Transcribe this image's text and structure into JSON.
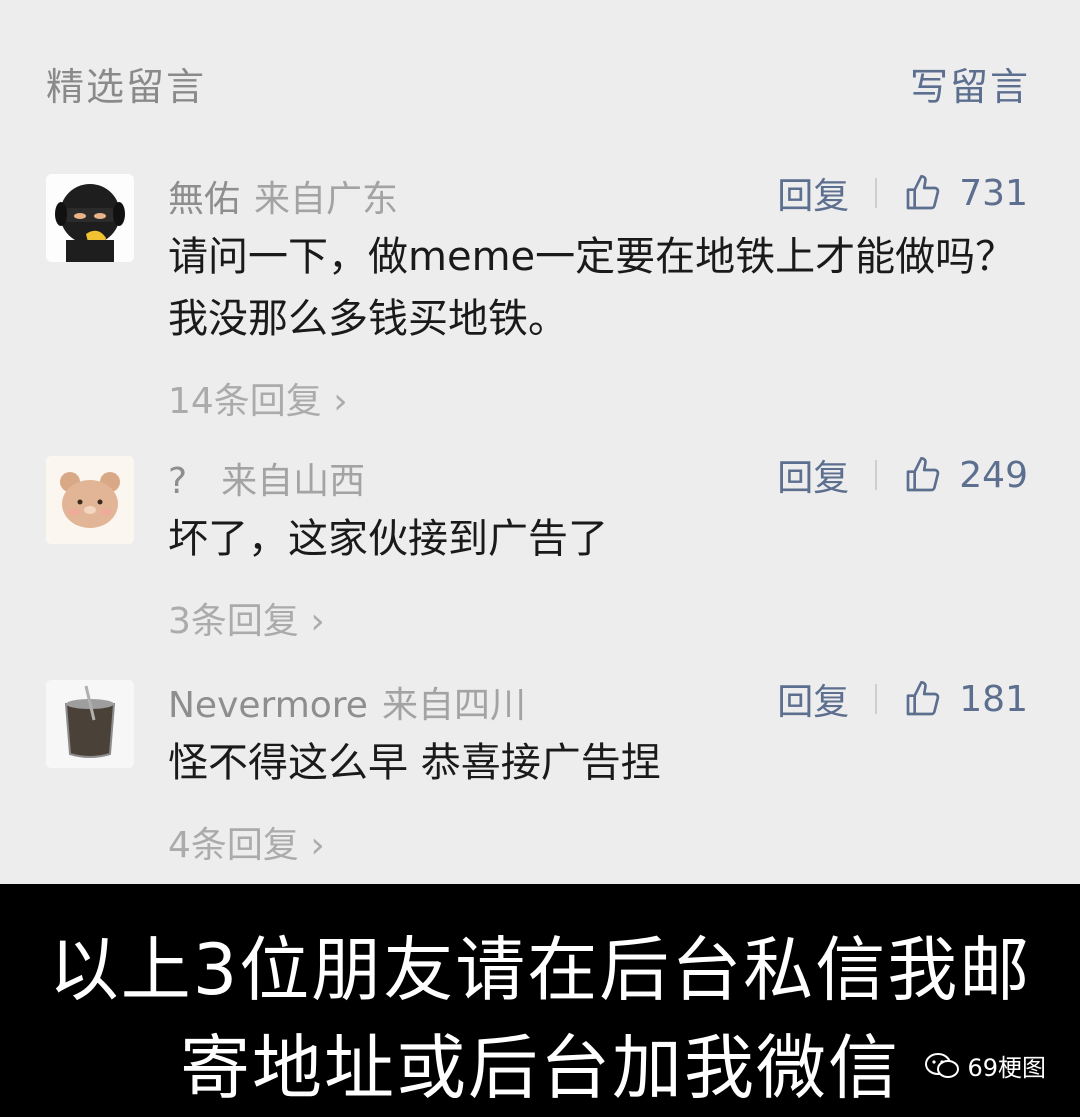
{
  "header": {
    "title": "精选留言",
    "write_label": "写留言"
  },
  "comments": [
    {
      "name": "無佑",
      "location": "来自广东",
      "reply_label": "回复",
      "likes": "731",
      "text": "请问一下，做meme一定要在地铁上才能做吗？我没那么多钱买地铁。",
      "replies": "14条回复"
    },
    {
      "name": "?",
      "location": "来自山西",
      "reply_label": "回复",
      "likes": "249",
      "text": "坏了，这家伙接到广告了",
      "replies": "3条回复"
    },
    {
      "name": "Nevermore",
      "location": "来自四川",
      "reply_label": "回复",
      "likes": "181",
      "text": "怪不得这么早 恭喜接广告捏",
      "replies": "4条回复"
    }
  ],
  "caption": {
    "line1": "以上3位朋友请在后台私信我邮",
    "line2": "寄地址或后台加我微信"
  },
  "watermark": "69梗图",
  "colors": {
    "background": "#ededed",
    "link": "#5c6f8f",
    "caption_bg": "#000000"
  }
}
